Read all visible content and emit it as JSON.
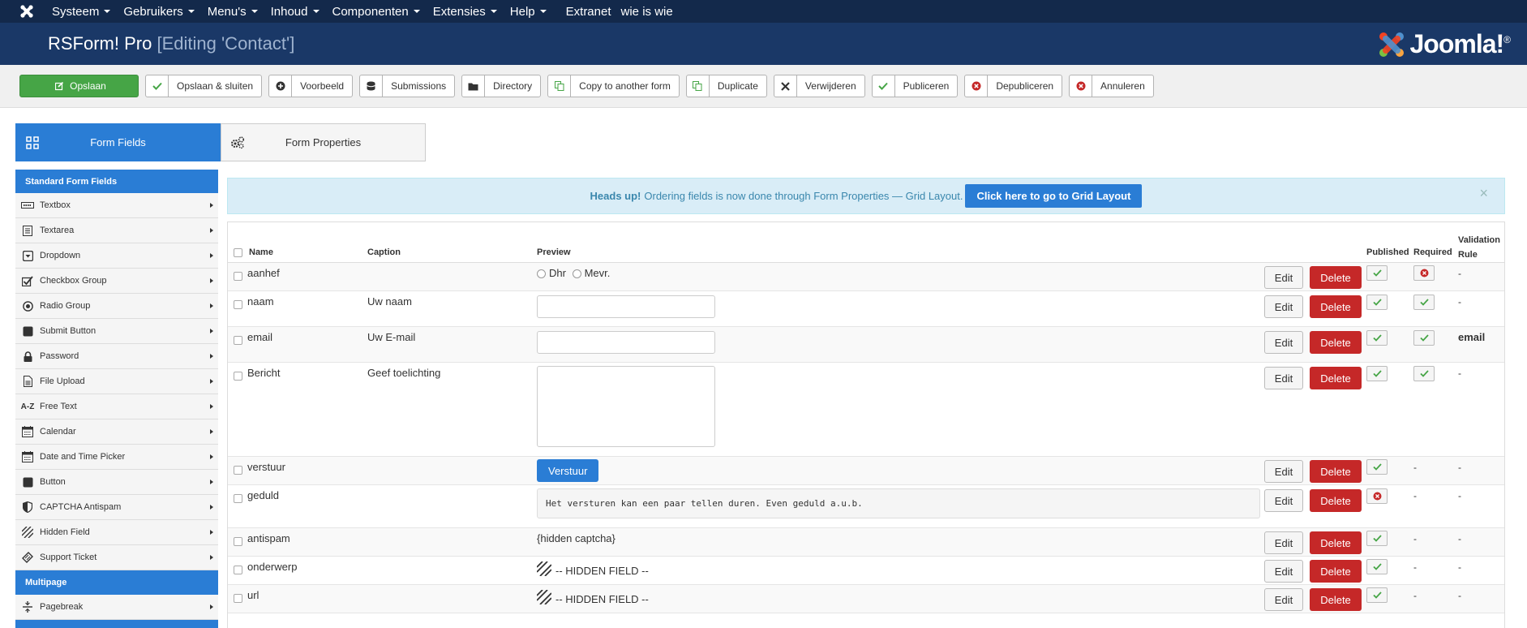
{
  "topnav": {
    "items": [
      {
        "label": "Systeem"
      },
      {
        "label": "Gebruikers"
      },
      {
        "label": "Menu's"
      },
      {
        "label": "Inhoud"
      },
      {
        "label": "Componenten"
      },
      {
        "label": "Extensies"
      },
      {
        "label": "Help"
      }
    ],
    "plain_items": [
      {
        "label": "Extranet"
      },
      {
        "label": "wie is wie"
      }
    ]
  },
  "header": {
    "title": "RSForm! Pro",
    "editing": "[Editing 'Contact']",
    "brand": "Joomla!",
    "brand_mark": "®"
  },
  "toolbar": {
    "save": "Opslaan",
    "buttons": [
      {
        "label": "Opslaan & sluiten",
        "icon": "check-icon"
      },
      {
        "label": "Voorbeeld",
        "icon": "plus-circle-icon"
      },
      {
        "label": "Submissions",
        "icon": "database-icon"
      },
      {
        "label": "Directory",
        "icon": "folder-icon"
      },
      {
        "label": "Copy to another form",
        "icon": "copy-icon"
      },
      {
        "label": "Duplicate",
        "icon": "copy-icon"
      },
      {
        "label": "Verwijderen",
        "icon": "x-icon"
      },
      {
        "label": "Publiceren",
        "icon": "check-icon"
      },
      {
        "label": "Depubliceren",
        "icon": "x-circle-icon"
      },
      {
        "label": "Annuleren",
        "icon": "x-circle-icon"
      }
    ]
  },
  "tabs": {
    "fields": "Form Fields",
    "properties": "Form Properties"
  },
  "sidebar": {
    "standard_head": "Standard Form Fields",
    "items": [
      {
        "label": "Textbox"
      },
      {
        "label": "Textarea"
      },
      {
        "label": "Dropdown"
      },
      {
        "label": "Checkbox Group"
      },
      {
        "label": "Radio Group"
      },
      {
        "label": "Submit Button"
      },
      {
        "label": "Password"
      },
      {
        "label": "File Upload"
      },
      {
        "label": "Free Text"
      },
      {
        "label": "Calendar"
      },
      {
        "label": "Date and Time Picker"
      },
      {
        "label": "Button"
      },
      {
        "label": "CAPTCHA Antispam"
      },
      {
        "label": "Hidden Field"
      },
      {
        "label": "Support Ticket"
      }
    ],
    "multipage_head": "Multipage",
    "multipage_items": [
      {
        "label": "Pagebreak"
      }
    ]
  },
  "alert": {
    "strong": "Heads up!",
    "text": "Ordering fields is now done through Form Properties — Grid Layout.",
    "button": "Click here to go to Grid Layout",
    "close": "×"
  },
  "table": {
    "headers": {
      "name": "Name",
      "caption": "Caption",
      "preview": "Preview",
      "published": "Published",
      "required": "Required",
      "validation_1": "Validation",
      "validation_2": "Rule"
    },
    "edit_label": "Edit",
    "delete_label": "Delete",
    "rows": [
      {
        "name": "aanhef",
        "caption": "",
        "preview_type": "radio",
        "radio_1": "Dhr",
        "radio_2": "Mevr.",
        "published": "yes",
        "required": "no",
        "validation": "-"
      },
      {
        "name": "naam",
        "caption": "Uw naam",
        "preview_type": "input",
        "published": "yes",
        "required": "yes",
        "validation": "-"
      },
      {
        "name": "email",
        "caption": "Uw E-mail",
        "preview_type": "input",
        "published": "yes",
        "required": "yes",
        "validation": "email"
      },
      {
        "name": "Bericht",
        "caption": "Geef toelichting",
        "preview_type": "textarea",
        "published": "yes",
        "required": "yes",
        "validation": "-"
      },
      {
        "name": "verstuur",
        "caption": "",
        "preview_type": "button",
        "preview_text": "Verstuur",
        "published": "yes",
        "required": "-",
        "validation": "-"
      },
      {
        "name": "geduld",
        "caption": "",
        "preview_type": "freetext",
        "preview_text": "Het versturen kan een paar tellen duren. Even geduld a.u.b.",
        "published": "no",
        "required": "-",
        "validation": "-"
      },
      {
        "name": "antispam",
        "caption": "",
        "preview_type": "text",
        "preview_text": "{hidden captcha}",
        "published": "yes",
        "required": "-",
        "validation": "-"
      },
      {
        "name": "onderwerp",
        "caption": "",
        "preview_type": "hidden",
        "preview_text": "-- HIDDEN FIELD --",
        "published": "yes",
        "required": "-",
        "validation": "-"
      },
      {
        "name": "url",
        "caption": "",
        "preview_type": "hidden",
        "preview_text": "-- HIDDEN FIELD --",
        "published": "yes",
        "required": "-",
        "validation": "-"
      }
    ]
  }
}
